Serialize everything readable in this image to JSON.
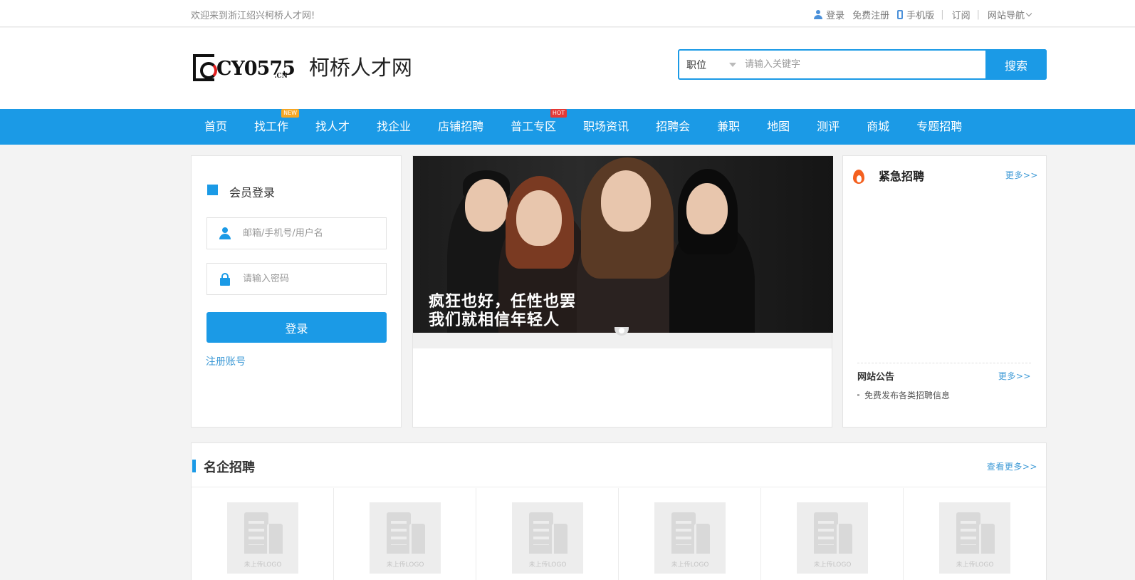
{
  "topbar": {
    "welcome": "欢迎来到浙江绍兴柯桥人才网!",
    "login": "登录",
    "register": "免费注册",
    "mobile": "手机版",
    "subscribe": "订阅",
    "site_nav": "网站导航"
  },
  "header": {
    "logo_text": "CY0575",
    "logo_domain": ".CN",
    "site_name": "柯桥人才网",
    "search": {
      "category": "职位",
      "placeholder": "请输入关键字",
      "button": "搜索"
    }
  },
  "nav": {
    "items": [
      {
        "label": "首页"
      },
      {
        "label": "找工作",
        "badge": "NEW"
      },
      {
        "label": "找人才"
      },
      {
        "label": "找企业"
      },
      {
        "label": "店铺招聘"
      },
      {
        "label": "普工专区",
        "badge": "HOT"
      },
      {
        "label": "职场资讯"
      },
      {
        "label": "招聘会"
      },
      {
        "label": "兼职"
      },
      {
        "label": "地图"
      },
      {
        "label": "测评"
      },
      {
        "label": "商城"
      },
      {
        "label": "专题招聘"
      }
    ]
  },
  "login_panel": {
    "title": "会员登录",
    "username_placeholder": "邮箱/手机号/用户名",
    "password_placeholder": "请输入密码",
    "submit": "登录",
    "register_link": "注册账号"
  },
  "banner": {
    "caption_line1": "疯狂也好，任性也罢",
    "caption_line2": "我们就相信年轻人"
  },
  "urgent": {
    "title": "紧急招聘",
    "more": "更多>>",
    "notice": {
      "title": "网站公告",
      "more": "更多>>",
      "items": [
        "免费发布各类招聘信息"
      ]
    }
  },
  "famous": {
    "title": "名企招聘",
    "more": "查看更多>>",
    "logo_placeholder": "未上传LOGO"
  },
  "colors": {
    "accent": "#1b9ae6",
    "new_badge": "#f5a623",
    "hot_badge": "#e53935",
    "fire": "#f4601f"
  }
}
